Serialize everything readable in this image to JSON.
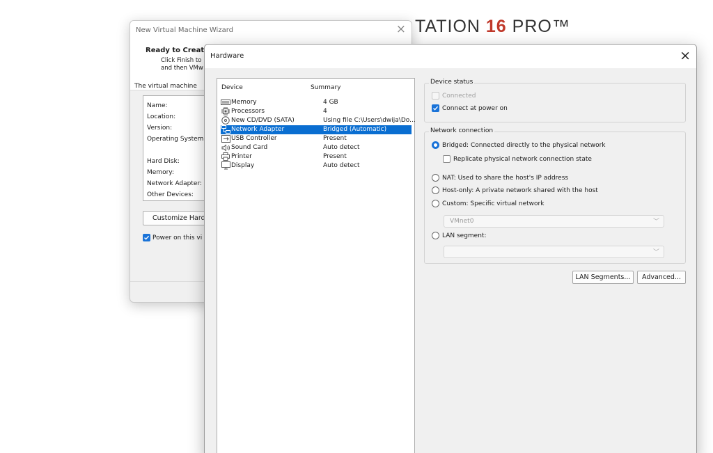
{
  "brand": {
    "text": "TATION ",
    "version": "16",
    "suffix": " PRO™"
  },
  "wizard": {
    "title": "New Virtual Machine Wizard",
    "heading": "Ready to Creat",
    "sub1": "Click Finish to",
    "sub2": "and then VMw",
    "intro": "The virtual machine",
    "labels": [
      "Name:",
      "Location:",
      "Version:",
      "Operating System",
      "Hard Disk:",
      "Memory:",
      "Network Adapter:",
      "Other Devices:"
    ],
    "customize_button": "Customize Hardw",
    "power_on": "Power on this vi"
  },
  "hardware": {
    "title": "Hardware",
    "columns": {
      "device": "Device",
      "summary": "Summary"
    },
    "devices": [
      {
        "icon": "memory-icon",
        "name": "Memory",
        "summary": "4 GB"
      },
      {
        "icon": "processor-icon",
        "name": "Processors",
        "summary": "4"
      },
      {
        "icon": "cd-dvd-icon",
        "name": "New CD/DVD (SATA)",
        "summary": "Using file C:\\Users\\dwija\\Do..."
      },
      {
        "icon": "network-adapter-icon",
        "name": "Network Adapter",
        "summary": "Bridged (Automatic)"
      },
      {
        "icon": "usb-icon",
        "name": "USB Controller",
        "summary": "Present"
      },
      {
        "icon": "speaker-icon",
        "name": "Sound Card",
        "summary": "Auto detect"
      },
      {
        "icon": "printer-icon",
        "name": "Printer",
        "summary": "Present"
      },
      {
        "icon": "display-icon",
        "name": "Display",
        "summary": "Auto detect"
      }
    ],
    "selected_device": "Network Adapter",
    "device_status": {
      "legend": "Device status",
      "connected": "Connected",
      "connect_at_power_on": "Connect at power on"
    },
    "network_connection": {
      "legend": "Network connection",
      "bridged": "Bridged: Connected directly to the physical network",
      "replicate": "Replicate physical network connection state",
      "nat": "NAT: Used to share the host's IP address",
      "host_only": "Host-only: A private network shared with the host",
      "custom": "Custom: Specific virtual network",
      "vmnet_value": "VMnet0",
      "lan_segment": "LAN segment:",
      "lan_segment_value": "",
      "selected": "bridged"
    },
    "buttons": {
      "lan_segments": "LAN Segments...",
      "advanced": "Advanced..."
    }
  },
  "colors": {
    "accent": "#1a73d8",
    "selection": "#0a6ed1",
    "brand_red": "#c0392b"
  }
}
